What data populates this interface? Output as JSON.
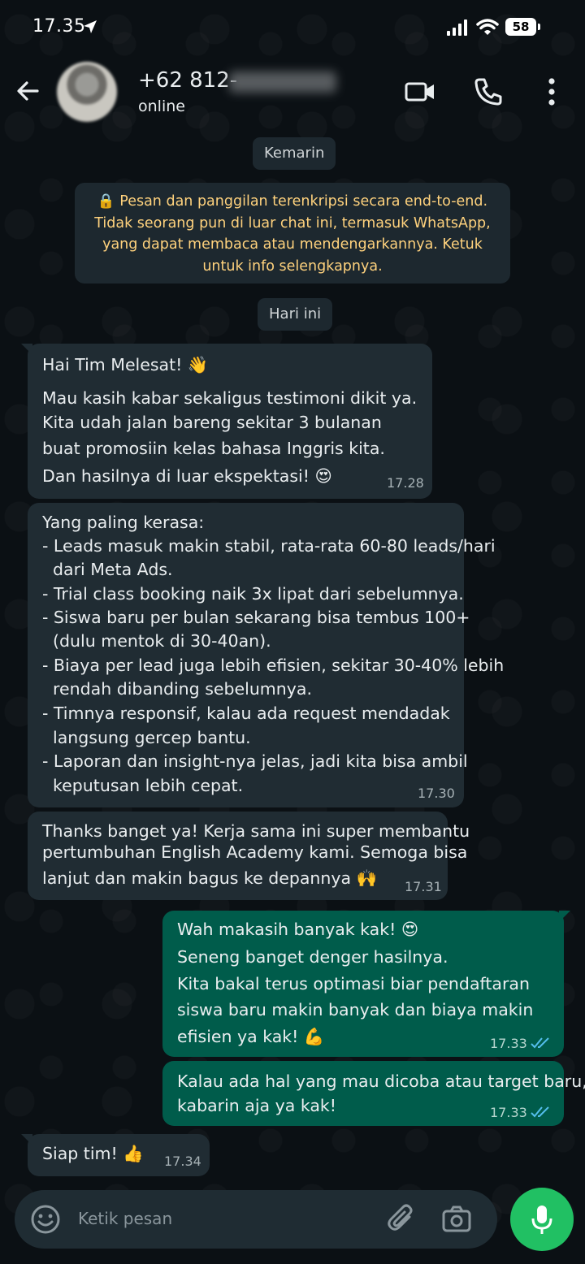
{
  "status_bar": {
    "time": "17.35",
    "battery": "58"
  },
  "header": {
    "contact_name": "+62 812-",
    "contact_status": "online"
  },
  "chat": {
    "date_yesterday": "Kemarin",
    "encryption_lines": [
      "🔒 Pesan dan panggilan terenkripsi secara end-to-end.",
      "Tidak seorang pun di luar chat ini, termasuk WhatsApp,",
      "yang dapat membaca atau mendengarkannya. Ketuk",
      "untuk info selengkapnya."
    ],
    "date_today": "Hari ini",
    "messages": [
      {
        "direction": "in",
        "lines": [
          "Hai Tim Melesat! 👋",
          "Mau kasih kabar sekaligus testimoni dikit ya.",
          "Kita udah jalan bareng sekitar 3 bulanan",
          "buat promosiin kelas bahasa Inggris kita.",
          "Dan hasilnya di luar ekspektasi! 😍"
        ],
        "time": "17.28"
      },
      {
        "direction": "in",
        "lines": [
          "Yang paling kerasa:",
          "- Leads masuk makin stabil, rata-rata 60-80 leads/hari",
          "  dari Meta Ads.",
          "- Trial class booking naik 3x lipat dari sebelumnya.",
          "- Siswa baru per bulan sekarang bisa tembus 100+",
          "  (dulu mentok di 30-40an).",
          "- Biaya per lead juga lebih efisien, sekitar 30-40% lebih",
          "  rendah dibanding sebelumnya.",
          "- Timnya responsif, kalau ada request mendadak",
          "  langsung gercep bantu.",
          "- Laporan dan insight-nya jelas, jadi kita bisa ambil",
          "  keputusan lebih cepat."
        ],
        "time": "17.30"
      },
      {
        "direction": "in",
        "lines": [
          "Thanks banget ya! Kerja sama ini super membantu",
          "pertumbuhan English Academy kami. Semoga bisa",
          "lanjut dan makin bagus ke depannya 🙌"
        ],
        "time": "17.31"
      },
      {
        "direction": "out",
        "lines": [
          "Wah makasih banyak kak! 😍",
          "Seneng banget denger hasilnya.",
          "Kita bakal terus optimasi biar pendaftaran",
          "siswa baru makin banyak dan biaya makin",
          "efisien ya kak! 💪"
        ],
        "time": "17.33",
        "status": "read"
      },
      {
        "direction": "out",
        "lines": [
          "Kalau ada hal yang mau dicoba atau target baru,",
          "kabarin aja ya kak!"
        ],
        "time": "17.33",
        "status": "read"
      },
      {
        "direction": "in",
        "lines": [
          "Siap tim! 👍"
        ],
        "time": "17.34"
      }
    ]
  },
  "input": {
    "placeholder": "Ketik pesan"
  },
  "icons": {
    "back": "arrow-left-icon",
    "video": "video-camera-icon",
    "call": "phone-icon",
    "more": "more-vertical-icon",
    "emoji": "emoji-icon",
    "attach": "paperclip-icon",
    "camera": "camera-icon",
    "mic": "microphone-icon"
  },
  "colors": {
    "background": "#0b1014",
    "incoming_bubble": "#202c33",
    "outgoing_bubble": "#005c4b",
    "encryption_text": "#ffd27d",
    "read_ticks": "#53bdeb",
    "mic_button": "#21c063"
  }
}
